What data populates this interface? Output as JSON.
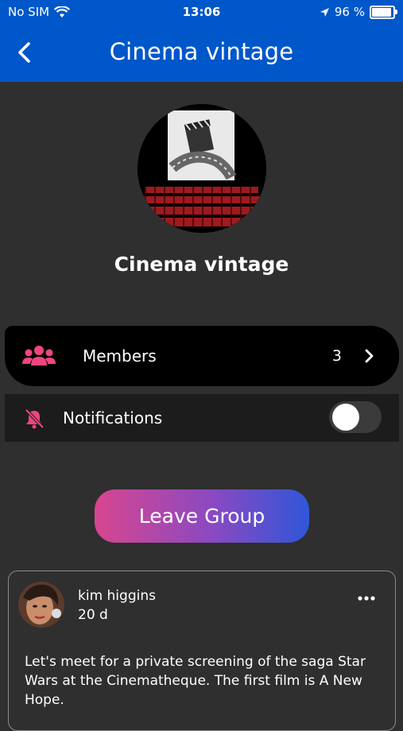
{
  "status_bar": {
    "carrier": "No SIM",
    "time": "13:06",
    "battery": "96 %"
  },
  "header": {
    "title": "Cinema vintage"
  },
  "group": {
    "name": "Cinema vintage"
  },
  "members": {
    "label": "Members",
    "count": "3"
  },
  "notifications": {
    "label": "Notifications",
    "enabled": false
  },
  "actions": {
    "leave_label": "Leave Group"
  },
  "post": {
    "author": "kim higgins",
    "time": "20 d",
    "text": "Let's meet for a private screening of the saga Star Wars at the Cinematheque. The first film is A New Hope."
  },
  "colors": {
    "header": "#0057c9",
    "accent_pink": "#f0457d",
    "background": "#2f2f2f"
  }
}
